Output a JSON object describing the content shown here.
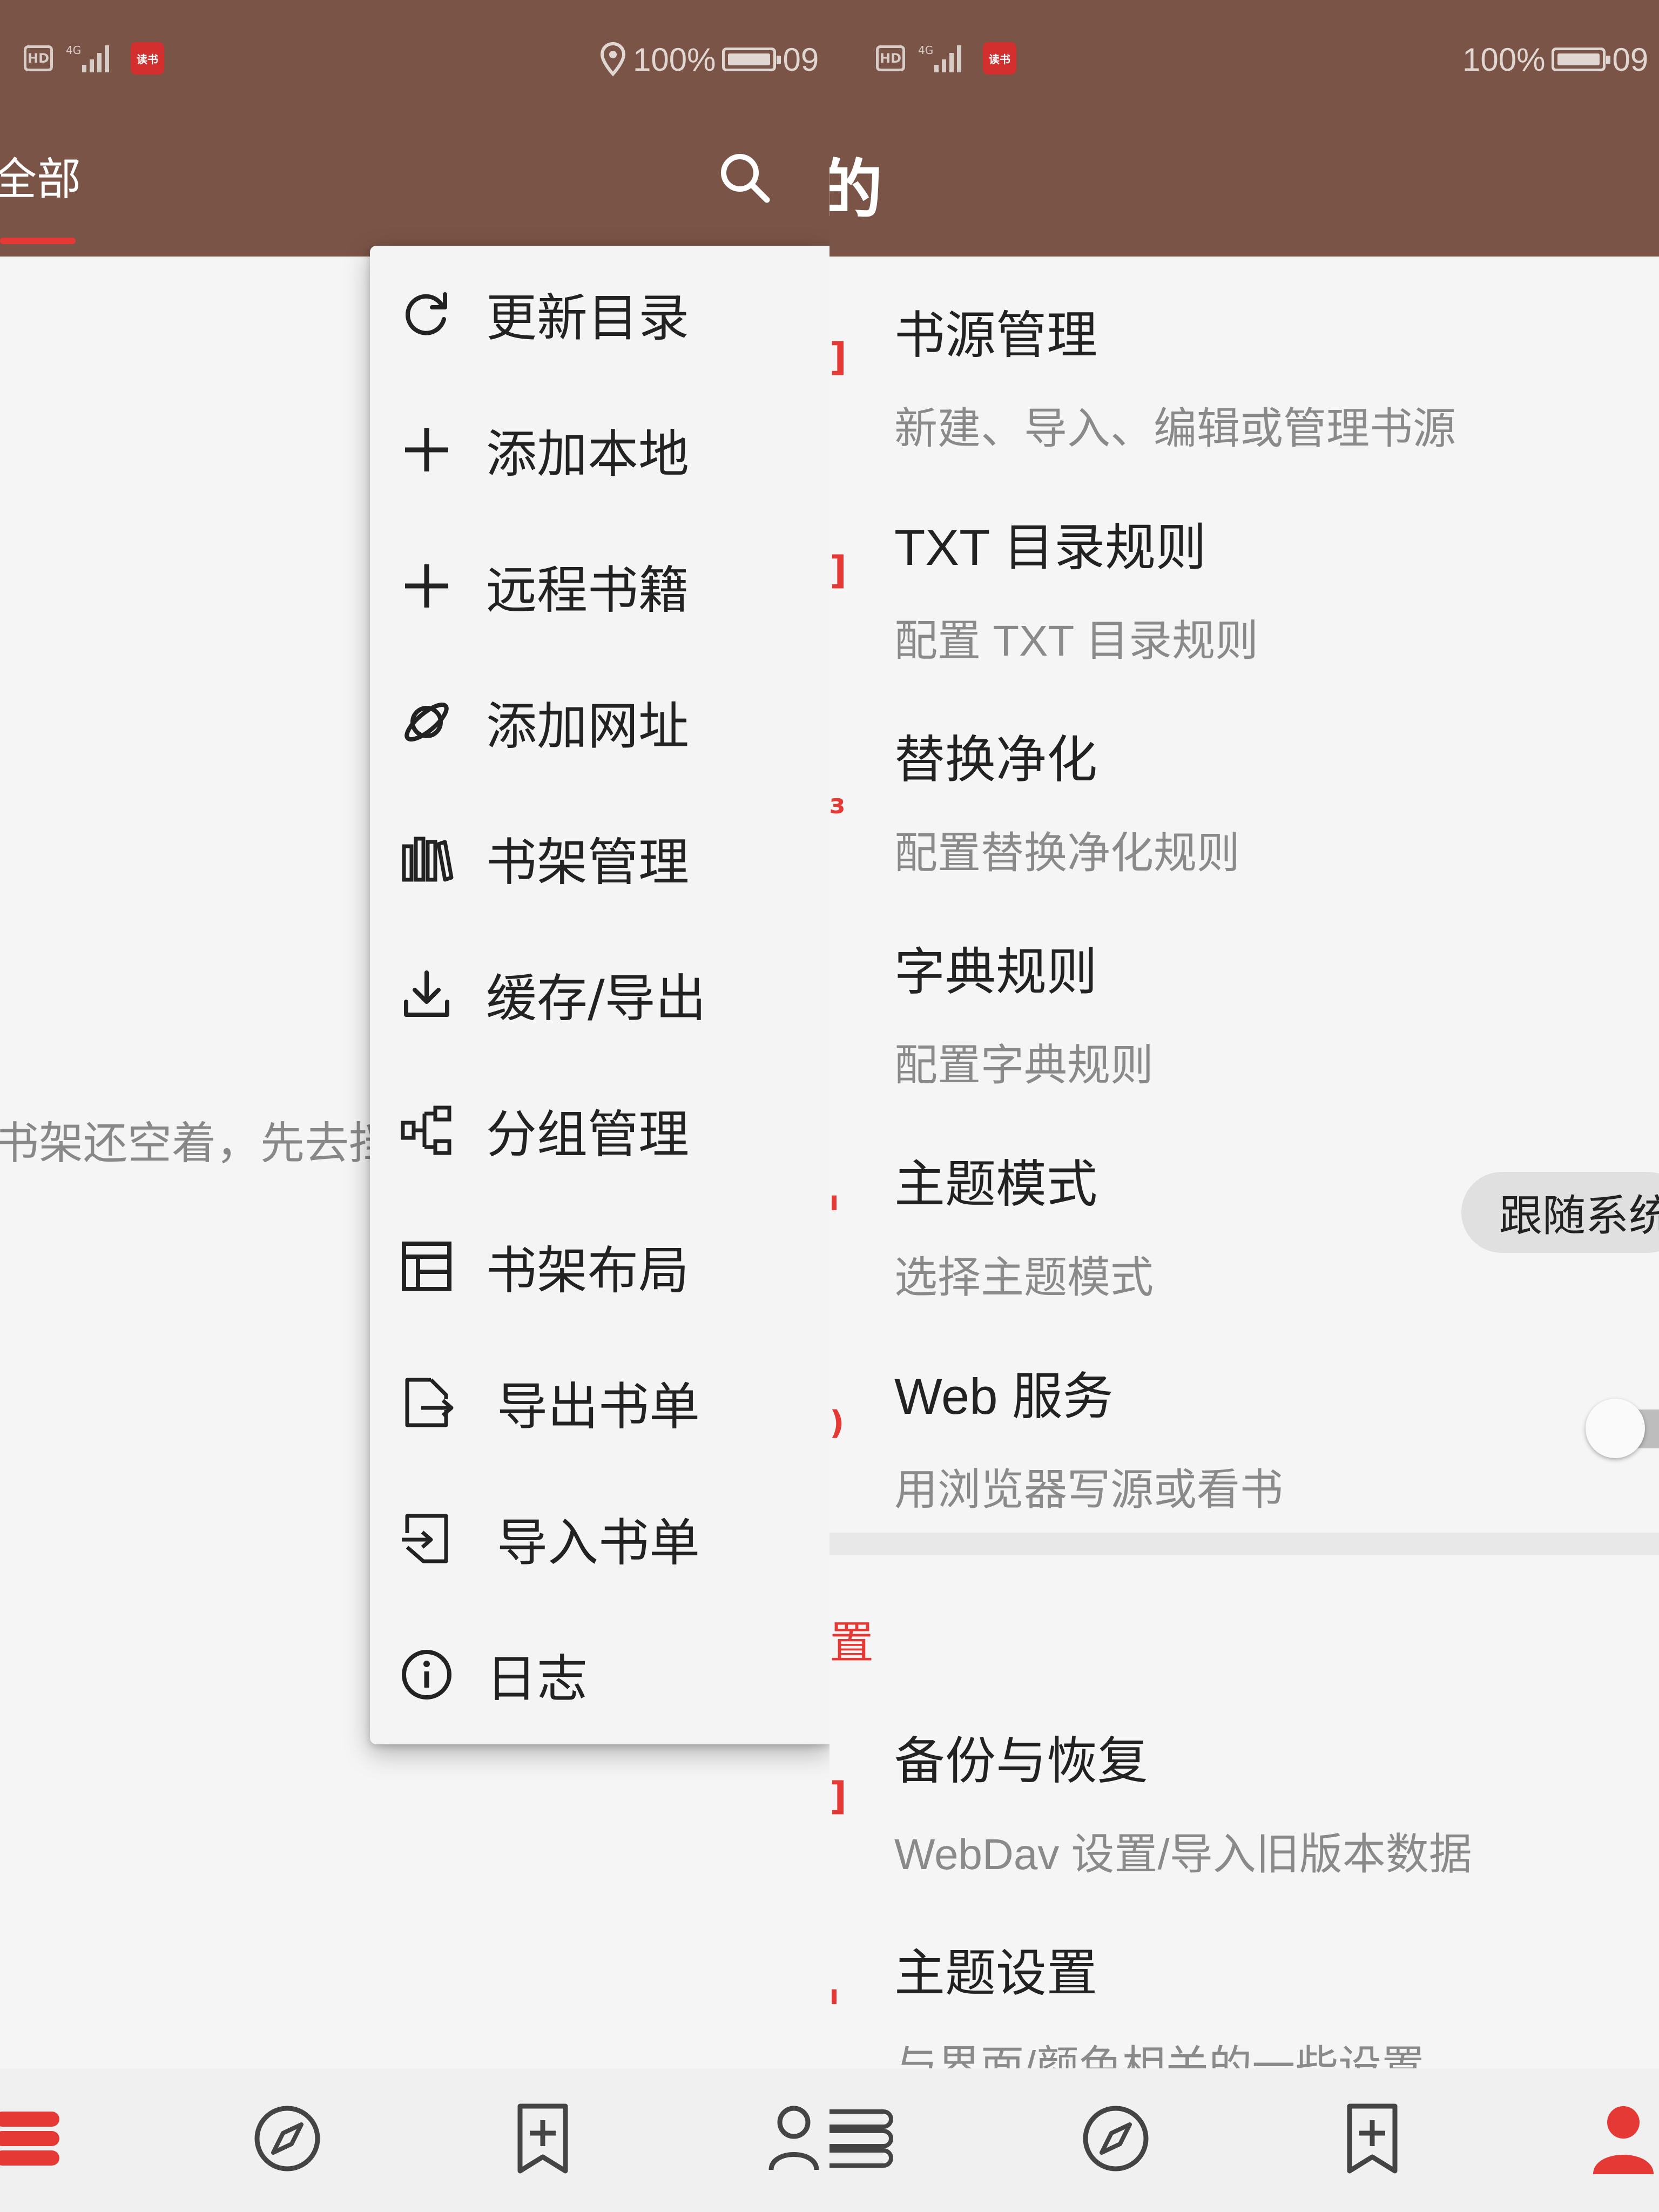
{
  "status_bar": {
    "hd_label": "HD",
    "network_label": "4G",
    "app_badge": "读书",
    "battery_percent": "100%",
    "time_partial": "09"
  },
  "colors": {
    "toolbar": "#7a5447",
    "accent": "#e53935",
    "background": "#f5f5f5",
    "menu_background": "#f4f4f4"
  },
  "shelf": {
    "tab_all_label": "全部",
    "empty_hint": "书架还空着，先去挡"
  },
  "popup_menu": {
    "items": [
      {
        "label": "更新目录",
        "icon": "refresh-icon"
      },
      {
        "label": "添加本地",
        "icon": "plus-icon"
      },
      {
        "label": "远程书籍",
        "icon": "plus-icon"
      },
      {
        "label": "添加网址",
        "icon": "planet-icon"
      },
      {
        "label": "书架管理",
        "icon": "bookshelf-icon"
      },
      {
        "label": "缓存/导出",
        "icon": "download-icon"
      },
      {
        "label": "分组管理",
        "icon": "group-icon"
      },
      {
        "label": "书架布局",
        "icon": "layout-icon"
      },
      {
        "label": "导出书单",
        "icon": "export-icon"
      },
      {
        "label": "导入书单",
        "icon": "import-icon"
      },
      {
        "label": "日志",
        "icon": "info-icon"
      }
    ]
  },
  "my_page": {
    "title_partial": "的",
    "prefs": [
      {
        "title": "书源管理",
        "summary": "新建、导入、编辑或管理书源"
      },
      {
        "title": "TXT 目录规则",
        "summary": "配置 TXT 目录规则"
      },
      {
        "title": "替换净化",
        "summary": "配置替换净化规则"
      },
      {
        "title": "字典规则",
        "summary": "配置字典规则"
      },
      {
        "title": "主题模式",
        "summary": "选择主题模式"
      },
      {
        "title": "Web 服务",
        "summary": "用浏览器写源或看书"
      }
    ],
    "theme_mode_value": "跟随系统",
    "web_service_enabled": false,
    "section_title_partial": "置",
    "settings_prefs": [
      {
        "title": "备份与恢复",
        "summary": "WebDav 设置/导入旧版本数据"
      },
      {
        "title": "主题设置",
        "summary": "与界面/颜色相关的一些设置"
      }
    ]
  },
  "bottom_nav": {
    "left": [
      "bookshelf-icon",
      "explore-icon",
      "rss-icon",
      "my-icon"
    ],
    "right": [
      "bookshelf-icon",
      "explore-icon",
      "rss-icon",
      "my-icon"
    ]
  }
}
